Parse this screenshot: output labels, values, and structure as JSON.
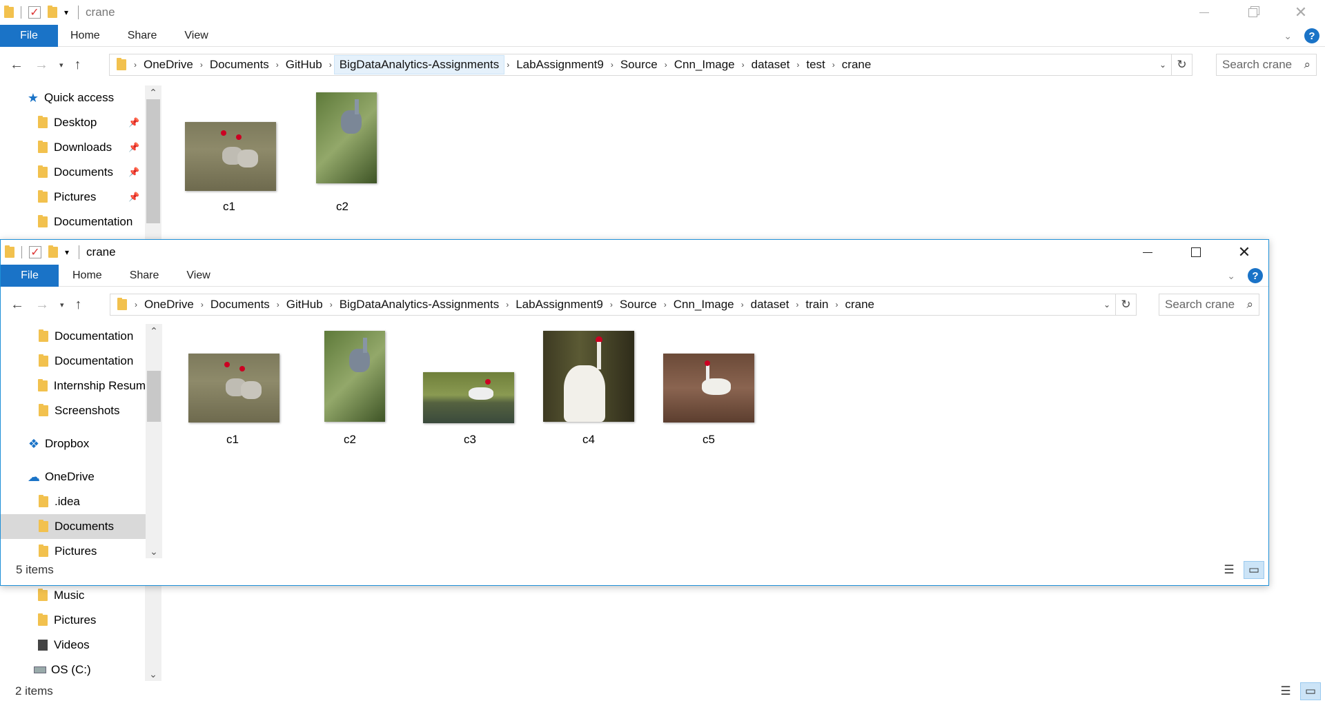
{
  "back": {
    "title": "crane",
    "ribbon": {
      "file": "File",
      "tabs": [
        "Home",
        "Share",
        "View"
      ]
    },
    "path": [
      "OneDrive",
      "Documents",
      "GitHub",
      "BigDataAnalytics-Assignments",
      "LabAssignment9",
      "Source",
      "Cnn_Image",
      "dataset",
      "test",
      "crane"
    ],
    "search_placeholder": "Search crane",
    "nav": {
      "quick_access": "Quick access",
      "items": [
        "Desktop",
        "Downloads",
        "Documents",
        "Pictures",
        "Documentation"
      ],
      "lower_items": [
        "Music",
        "Pictures",
        "Videos",
        "OS (C:)"
      ]
    },
    "files": [
      "c1",
      "c2"
    ],
    "status": "2 items"
  },
  "front": {
    "title": "crane",
    "ribbon": {
      "file": "File",
      "tabs": [
        "Home",
        "Share",
        "View"
      ]
    },
    "path": [
      "OneDrive",
      "Documents",
      "GitHub",
      "BigDataAnalytics-Assignments",
      "LabAssignment9",
      "Source",
      "Cnn_Image",
      "dataset",
      "train",
      "crane"
    ],
    "search_placeholder": "Search crane",
    "nav": {
      "folders": [
        "Documentation",
        "Documentation",
        "Internship Resum",
        "Screenshots"
      ],
      "dropbox": "Dropbox",
      "onedrive": "OneDrive",
      "od_items": [
        ".idea",
        "Documents",
        "Pictures"
      ]
    },
    "files": [
      "c1",
      "c2",
      "c3",
      "c4",
      "c5"
    ],
    "status": "5 items"
  },
  "colors": {
    "accent": "#1a73c7",
    "selection": "#d9d9d9",
    "folder": "#f2c14e"
  }
}
